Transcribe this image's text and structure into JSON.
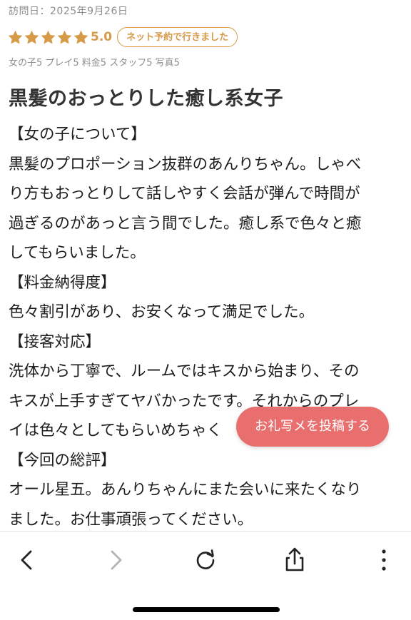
{
  "review": {
    "visit_date": "訪問日：2025年9月26日",
    "rating_value": 5,
    "rating_score": "5.0",
    "booking_badge": "ネット予約で行きました",
    "sub_ratings": "女の子5 プレイ5 料金5 スタッフ5 写真5",
    "title": "黒髪のおっとりした癒し系女子",
    "body_lines": [
      "【女の子について】",
      "黒髪のプロポーション抜群のあんりちゃん。しゃべ",
      "り方もおっとりして話しやすく会話が弾んで時間が",
      "過ぎるのがあっと言う間でした。癒し系で色々と癒",
      "してもらいました。",
      "【料金納得度】",
      "色々割引があり、お安くなって満足でした。",
      "【接客対応】",
      "洗体から丁寧で、ルームではキスから始まり、その",
      "キスが上手すぎてヤバかったです。それからのプレ",
      "イは色々としてもらいめちゃく",
      "【今回の総評】",
      "オール星五。あんりちゃんにまた会いに来たくなり",
      "ました。お仕事頑張ってください。"
    ]
  },
  "floating_button": {
    "label": "お礼写メを投稿する"
  },
  "browser_toolbar": {
    "icons": [
      "back-icon",
      "forward-icon",
      "reload-icon",
      "share-icon",
      "more-icon"
    ]
  },
  "colors": {
    "star": "#d69a49",
    "accent": "#d69a49",
    "float_button": "#e96f6f",
    "forward_disabled": "#b4b4b4"
  }
}
